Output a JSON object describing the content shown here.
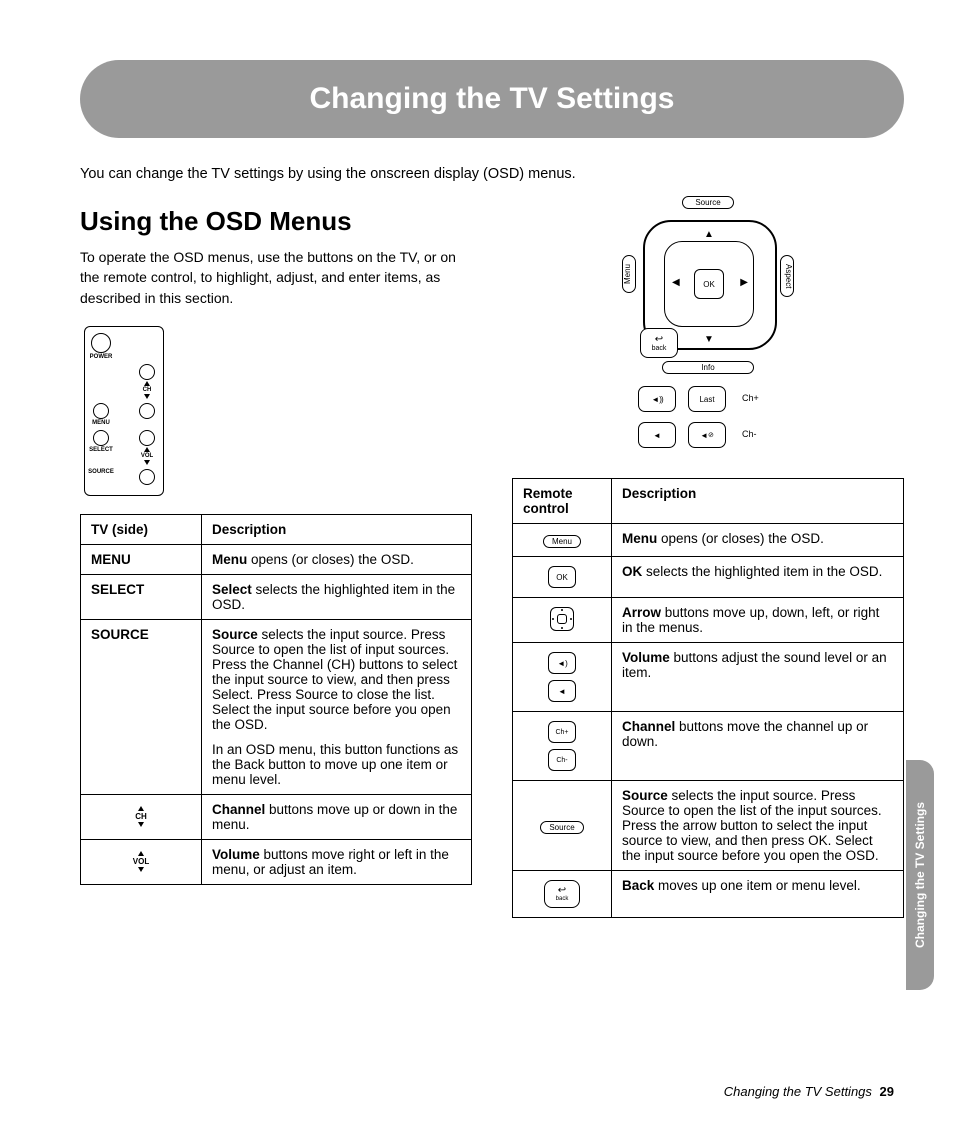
{
  "banner_title": "Changing the TV Settings",
  "intro": "You can change the TV settings by using the onscreen display (OSD) menus.",
  "section_heading": "Using the OSD Menus",
  "osd_para": "To operate the OSD menus, use the buttons on the TV, or on the remote control, to highlight, adjust, and enter items, as described in this section.",
  "tv_diagram": {
    "power": "POWER",
    "ch": "CH",
    "menu": "MENU",
    "select": "SELECT",
    "vol": "VOL",
    "source": "SOURCE"
  },
  "remote_diagram": {
    "source": "Source",
    "menu": "Menu",
    "aspect": "Aspect",
    "ok": "OK",
    "back": "back",
    "info": "Info",
    "last": "Last",
    "ch_plus": "Ch+",
    "ch_minus": "Ch-"
  },
  "tv_table": {
    "head_key": "TV (side)",
    "head_desc": "Description",
    "rows": [
      {
        "key": "MENU",
        "bold": "Menu",
        "rest": " opens (or closes) the OSD."
      },
      {
        "key": "SELECT",
        "bold": "Select",
        "rest": " selects the highlighted item in the OSD."
      },
      {
        "key": "SOURCE",
        "bold": "Source",
        "rest": " selects the input source. Press Source to open the list of input sources. Press the Channel (CH) buttons to select the input source to view, and then press Select. Press Source to close the list. Select the input source before you open the OSD.",
        "para2": "In an OSD menu, this button functions as the Back button to move up one item or menu level."
      },
      {
        "key": "CH",
        "icon": "ch",
        "bold": "Channel",
        "rest": " buttons move up or down in the menu."
      },
      {
        "key": "VOL",
        "icon": "vol",
        "bold": "Volume",
        "rest": " buttons move right or left in the menu, or adjust an item."
      }
    ]
  },
  "remote_table": {
    "head_key": "Remote control",
    "head_desc": "Description",
    "rows": [
      {
        "icon": "menu",
        "label": "Menu",
        "bold": "Menu",
        "rest": " opens (or closes) the OSD."
      },
      {
        "icon": "ok",
        "label": "OK",
        "bold": "OK",
        "rest": " selects the highlighted item in the OSD."
      },
      {
        "icon": "arrows",
        "bold": "Arrow",
        "rest": " buttons move up, down, left, or right in the menus."
      },
      {
        "icon": "vol",
        "bold": "Volume",
        "rest": " buttons adjust the sound level or an item."
      },
      {
        "icon": "ch",
        "label_up": "Ch+",
        "label_dn": "Ch-",
        "bold": "Channel",
        "rest": " buttons move the channel up or down."
      },
      {
        "icon": "source",
        "label": "Source",
        "bold": "Source",
        "rest": " selects the input source. Press Source to open the list of the input sources. Press the arrow button to select the input source to view, and then press OK. Select the input source before you open the OSD."
      },
      {
        "icon": "back",
        "label": "back",
        "bold": "Back",
        "rest": " moves up one item or menu level."
      }
    ]
  },
  "side_tab": "Changing the TV Settings",
  "footer_text": "Changing the TV Settings",
  "page_number": "29"
}
